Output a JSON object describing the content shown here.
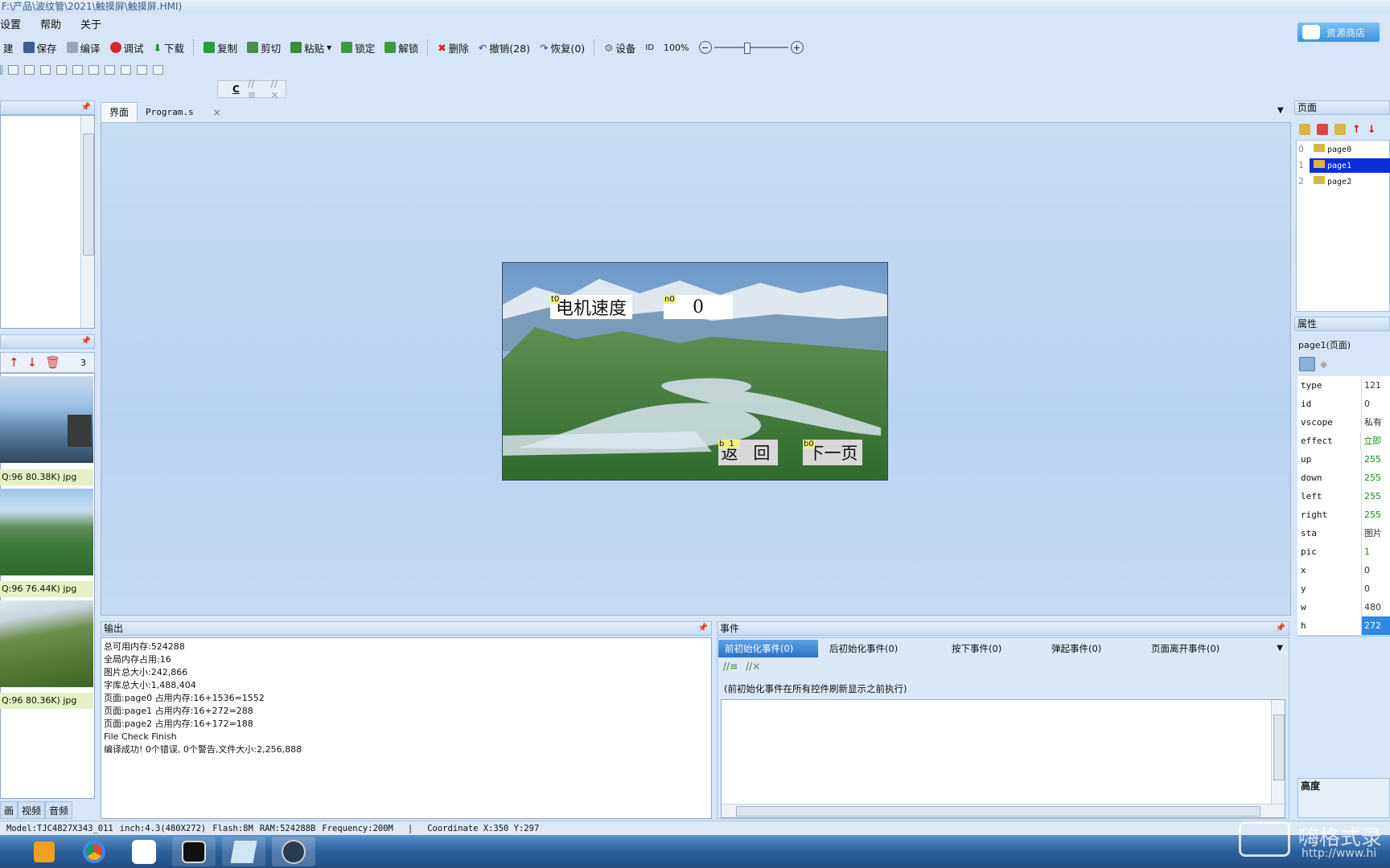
{
  "window": {
    "title": "F:\\产品\\波纹管\\2021\\触摸屏\\触摸屏.HMI)"
  },
  "menu": [
    "设置",
    "帮助",
    "关于"
  ],
  "toolbar": {
    "items": [
      "建",
      "保存",
      "编译",
      "调试",
      "下载",
      "复制",
      "剪切",
      "粘贴",
      "锁定",
      "解锁",
      "删除",
      "撤销(28)",
      "恢复(0)",
      "设备",
      "ID",
      "100%"
    ]
  },
  "code_toolbar": {
    "label": "C"
  },
  "cloud_button": {
    "label": "资源商店"
  },
  "left_panel": {
    "pic_count": "3",
    "pictures": [
      {
        "label": "Q:96 80.38K) jpg"
      },
      {
        "label": "Q:96 76.44K) jpg"
      },
      {
        "label": "Q:96 80.36K) jpg"
      }
    ],
    "bottom_tabs": [
      "画",
      "视频",
      "音频"
    ]
  },
  "editor_tabs": {
    "tab1": "界面",
    "tab2": "Program.s",
    "close": "×"
  },
  "hmi": {
    "t0": {
      "tag": "t0",
      "text": "电机速度"
    },
    "n0": {
      "tag": "n0",
      "text": "0"
    },
    "b1": {
      "tag": "b1",
      "text": "返 回"
    },
    "b0": {
      "tag": "b0",
      "text": "下一页"
    }
  },
  "output": {
    "title": "输出",
    "lines": [
      "总可用内存:524288",
      "全局内存占用:16",
      "图片总大小:242,866",
      "字库总大小:1,488,404",
      "页面:page0 占用内存:16+1536=1552",
      "页面:page1 占用内存:16+272=288",
      "页面:page2 占用内存:16+172=188",
      "File Check Finish",
      "编译成功! 0个错误, 0个警告,文件大小:2,256,888"
    ]
  },
  "events": {
    "title": "事件",
    "tabs": [
      "前初始化事件(0)",
      "后初始化事件(0)",
      "按下事件(0)",
      "弹起事件(0)",
      "页面离开事件(0)"
    ],
    "hint": "(前初始化事件在所有控件刷新显示之前执行)"
  },
  "pages_panel": {
    "title": "页面",
    "pages": [
      {
        "index": "0",
        "name": "page0"
      },
      {
        "index": "1",
        "name": "page1"
      },
      {
        "index": "2",
        "name": "page2"
      }
    ]
  },
  "props_panel": {
    "title": "属性",
    "object": "page1(页面)",
    "rows": [
      {
        "key": "type",
        "value": "121"
      },
      {
        "key": "id",
        "value": "0"
      },
      {
        "key": "vscope",
        "value": "私有"
      },
      {
        "key": "effect",
        "value": "立即加"
      },
      {
        "key": "up",
        "value": "255"
      },
      {
        "key": "down",
        "value": "255"
      },
      {
        "key": "left",
        "value": "255"
      },
      {
        "key": "right",
        "value": "255"
      },
      {
        "key": "sta",
        "value": "图片"
      },
      {
        "key": "pic",
        "value": "1"
      },
      {
        "key": "x",
        "value": "0"
      },
      {
        "key": "y",
        "value": "0"
      },
      {
        "key": "w",
        "value": "480"
      },
      {
        "key": "h",
        "value": "272"
      }
    ],
    "desc_title": "高度"
  },
  "status": {
    "model": "Model:TJC4827X343_011",
    "inch": "inch:4.3(480X272)",
    "flash": "Flash:8M",
    "ram": "RAM:524288B",
    "freq": "Frequency:200M",
    "coord": "Coordinate X:350  Y:297"
  },
  "watermark": {
    "text": "嗨格式录",
    "url": "http://www.hi"
  },
  "colors": {
    "accent": "#2d73c9",
    "selection": "#0a2fd8",
    "toolbar_bg": "#d6e6f8"
  }
}
